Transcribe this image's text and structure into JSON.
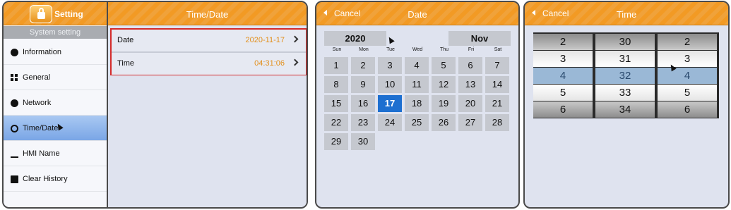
{
  "settings": {
    "app_title": "Setting",
    "section": "System setting",
    "header_title": "Time/Date",
    "sidebar": [
      {
        "label": "Information",
        "icon": "info-icon"
      },
      {
        "label": "General",
        "icon": "grid-icon"
      },
      {
        "label": "Network",
        "icon": "ip-icon"
      },
      {
        "label": "Time/Date",
        "icon": "clock-icon",
        "active": true
      },
      {
        "label": "HMI Name",
        "icon": "pen-icon"
      },
      {
        "label": "Clear History",
        "icon": "trash-icon"
      }
    ],
    "rows": [
      {
        "label": "Date",
        "value": "2020-11-17"
      },
      {
        "label": "Time",
        "value": "04:31:06"
      }
    ]
  },
  "date_picker": {
    "cancel": "Cancel",
    "title": "Date",
    "year": "2020",
    "month": "Nov",
    "weekdays": [
      "Sun",
      "Mon",
      "Tue",
      "Wed",
      "Thu",
      "Fri",
      "Sat"
    ],
    "days": [
      "1",
      "2",
      "3",
      "4",
      "5",
      "6",
      "7",
      "8",
      "9",
      "10",
      "11",
      "12",
      "13",
      "14",
      "15",
      "16",
      "17",
      "18",
      "19",
      "20",
      "21",
      "22",
      "23",
      "24",
      "25",
      "26",
      "27",
      "28",
      "29",
      "30"
    ],
    "selected_day": "17"
  },
  "time_picker": {
    "cancel": "Cancel",
    "title": "Time",
    "columns": [
      [
        "2",
        "3",
        "4",
        "5",
        "6"
      ],
      [
        "30",
        "31",
        "32",
        "33",
        "34"
      ],
      [
        "2",
        "3",
        "4",
        "5",
        "6"
      ]
    ]
  },
  "colors": {
    "accent_orange": "#f29a24",
    "value_orange": "#e38f1a",
    "selected_blue": "#1d6fd0",
    "highlight": "#d42b2b"
  }
}
